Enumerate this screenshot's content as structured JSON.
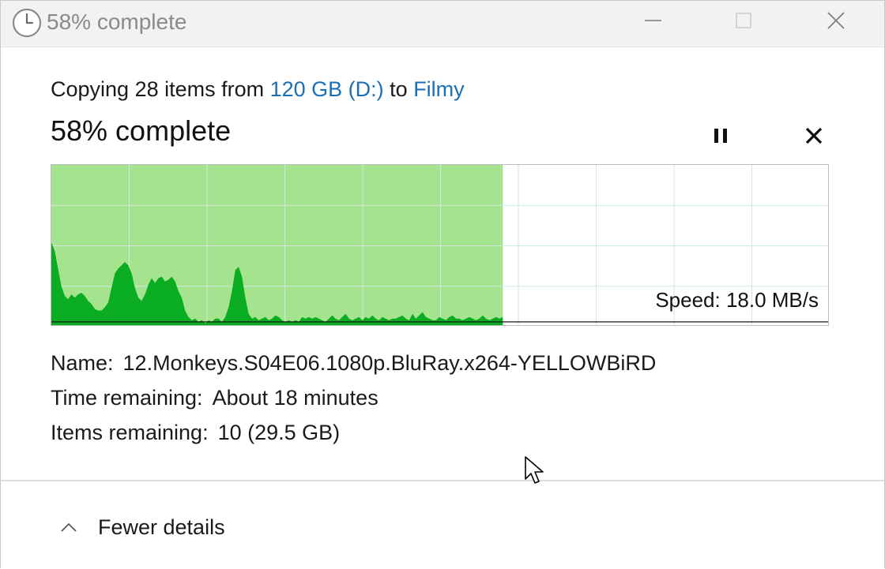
{
  "window": {
    "title": "58% complete",
    "controls": [
      "minimize",
      "maximize",
      "close"
    ]
  },
  "header": {
    "copy_prefix": "Copying 28 items from ",
    "source": "120 GB (D:)",
    "copy_middle": " to ",
    "destination": "Filmy",
    "percent_text": "58% complete"
  },
  "progress": {
    "percent": 58,
    "speed_text": "Speed: 18.0 MB/s",
    "speed_history": [
      0.52,
      0.47,
      0.36,
      0.25,
      0.19,
      0.17,
      0.2,
      0.18,
      0.2,
      0.21,
      0.19,
      0.16,
      0.14,
      0.11,
      0.1,
      0.1,
      0.12,
      0.15,
      0.24,
      0.33,
      0.36,
      0.38,
      0.4,
      0.38,
      0.33,
      0.24,
      0.18,
      0.16,
      0.2,
      0.26,
      0.3,
      0.27,
      0.3,
      0.31,
      0.28,
      0.29,
      0.31,
      0.28,
      0.22,
      0.18,
      0.1,
      0.06,
      0.04,
      0.05,
      0.03,
      0.04,
      0.02,
      0.04,
      0.03,
      0.05,
      0.05,
      0.03,
      0.06,
      0.12,
      0.22,
      0.35,
      0.37,
      0.31,
      0.18,
      0.08,
      0.05,
      0.06,
      0.04,
      0.05,
      0.06,
      0.04,
      0.05,
      0.07,
      0.06,
      0.04,
      0.03,
      0.04,
      0.03,
      0.04,
      0.03,
      0.06,
      0.05,
      0.06,
      0.05,
      0.06,
      0.05,
      0.04,
      0.03,
      0.05,
      0.07,
      0.05,
      0.04,
      0.06,
      0.08,
      0.05,
      0.04,
      0.05,
      0.06,
      0.04,
      0.06,
      0.05,
      0.07,
      0.05,
      0.04,
      0.06,
      0.05,
      0.04,
      0.05,
      0.05,
      0.06,
      0.07,
      0.05,
      0.04,
      0.08,
      0.05,
      0.07,
      0.09,
      0.06,
      0.05,
      0.04,
      0.04,
      0.06,
      0.05,
      0.04,
      0.06,
      0.07,
      0.05,
      0.05,
      0.04,
      0.05,
      0.06,
      0.05,
      0.04,
      0.05,
      0.07,
      0.05,
      0.04,
      0.05,
      0.06,
      0.05,
      0.06
    ],
    "current_speed_level": 0.03
  },
  "details": {
    "name_label": "Name:",
    "name_value": "12.Monkeys.S04E06.1080p.BluRay.x264-YELLOWBiRD",
    "time_label": "Time remaining:",
    "time_value": "About 18 minutes",
    "items_label": "Items remaining:",
    "items_value": "10 (29.5 GB)"
  },
  "footer": {
    "toggle_label": "Fewer details"
  },
  "colors": {
    "progress_fill": "#a6e38f",
    "speed_fill": "#0aad22",
    "grid": "#cfe9dc",
    "link": "#1a6fb5",
    "title_text": "#8a8a8a"
  },
  "icons": {
    "window": "clock-icon",
    "pause": "pause-icon",
    "cancel": "close-icon",
    "toggle": "chevron-up-icon"
  }
}
